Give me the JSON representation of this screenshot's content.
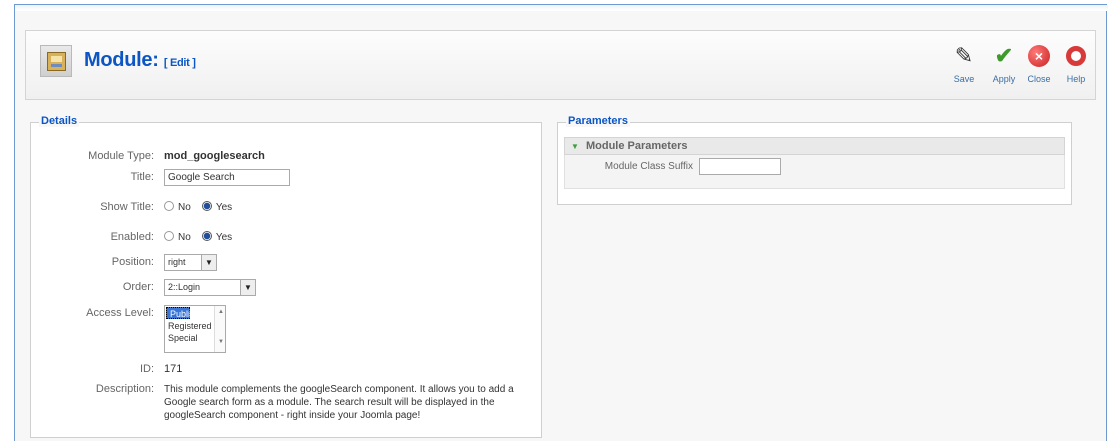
{
  "header": {
    "title": "Module:",
    "subtitle": "[ Edit ]",
    "toolbar": [
      {
        "label": "Save",
        "icon": "save-icon"
      },
      {
        "label": "Apply",
        "icon": "apply-check-icon"
      },
      {
        "label": "Close",
        "icon": "close-icon"
      },
      {
        "label": "Help",
        "icon": "help-lifebuoy-icon"
      }
    ]
  },
  "details": {
    "legend": "Details",
    "module_type_label": "Module Type:",
    "module_type_value": "mod_googlesearch",
    "title_label": "Title:",
    "title_value": "Google Search",
    "show_title_label": "Show Title:",
    "enabled_label": "Enabled:",
    "no_label": "No",
    "yes_label": "Yes",
    "show_title_selected": "Yes",
    "enabled_selected": "Yes",
    "position_label": "Position:",
    "position_value": "right",
    "order_label": "Order:",
    "order_value": "2::Login",
    "access_level_label": "Access Level:",
    "access_levels": [
      "Public",
      "Registered",
      "Special"
    ],
    "access_selected": "Public",
    "id_label": "ID:",
    "id_value": "171",
    "description_label": "Description:",
    "description_value": "This module complements the googleSearch component. It allows you to add a Google search form as a module. The search result will be displayed in the googleSearch component - right inside your Joomla page!"
  },
  "parameters": {
    "legend": "Parameters",
    "section_title": "Module Parameters",
    "class_suffix_label": "Module Class Suffix",
    "class_suffix_value": ""
  },
  "colors": {
    "title_blue": "#0b55c4",
    "selection_blue": "#3875d7",
    "apply_green": "#3e9a2a",
    "close_red": "#c81f1f"
  }
}
